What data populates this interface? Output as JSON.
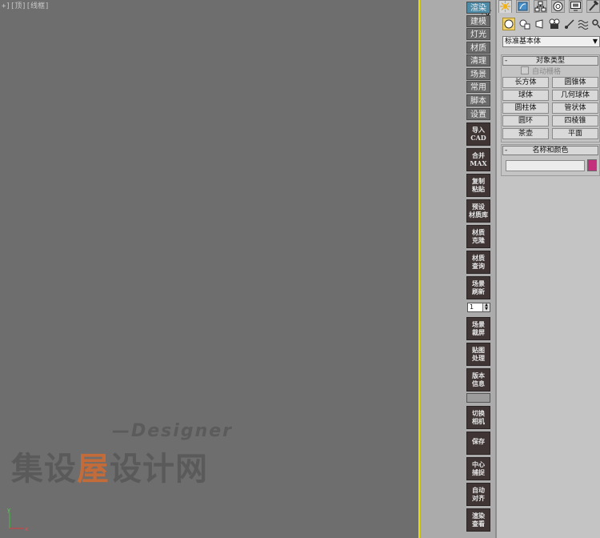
{
  "viewport": {
    "label": "+][顶][线框]"
  },
  "watermark": {
    "designer": "—Designer",
    "cn_1": "集设",
    "cn_accent": "屋",
    "cn_2": "设计网"
  },
  "axis": {
    "x": "x",
    "y": "y"
  },
  "menu": [
    "渲染",
    "建模",
    "灯光",
    "材质",
    "清理",
    "场景",
    "常用",
    "脚本",
    "设置"
  ],
  "tools": [
    {
      "l1": "导入",
      "l2": "CAD"
    },
    {
      "l1": "合并",
      "l2": "MAX"
    },
    {
      "l1": "复制",
      "l2": "粘贴"
    },
    {
      "l1": "预设",
      "l2": "材质库"
    },
    {
      "l1": "材质",
      "l2": "克隆"
    },
    {
      "l1": "材质",
      "l2": "查询"
    },
    {
      "l1": "场景",
      "l2": "刷新"
    }
  ],
  "spinner_value": "1",
  "tools2": [
    {
      "l1": "场景",
      "l2": "裁屏"
    },
    {
      "l1": "贴图",
      "l2": "处理"
    },
    {
      "l1": "版本",
      "l2": "信息"
    }
  ],
  "tools3": [
    {
      "l1": "切换",
      "l2": "相机"
    },
    {
      "l1": "保存",
      "l2": ""
    },
    {
      "l1": "中心",
      "l2": "捕捉"
    },
    {
      "l1": "自动",
      "l2": "对齐"
    },
    {
      "l1": "渲染",
      "l2": "查看"
    }
  ],
  "panel": {
    "dropdown": "标准基本体",
    "object_type": "对象类型",
    "auto_grid": "自动栅格",
    "objects": [
      "长方体",
      "圆锥体",
      "球体",
      "几何球体",
      "圆柱体",
      "管状体",
      "圆环",
      "四棱锥",
      "茶壶",
      "平面"
    ],
    "name_color": "名称和颜色",
    "swatch_color": "#c3317c"
  }
}
